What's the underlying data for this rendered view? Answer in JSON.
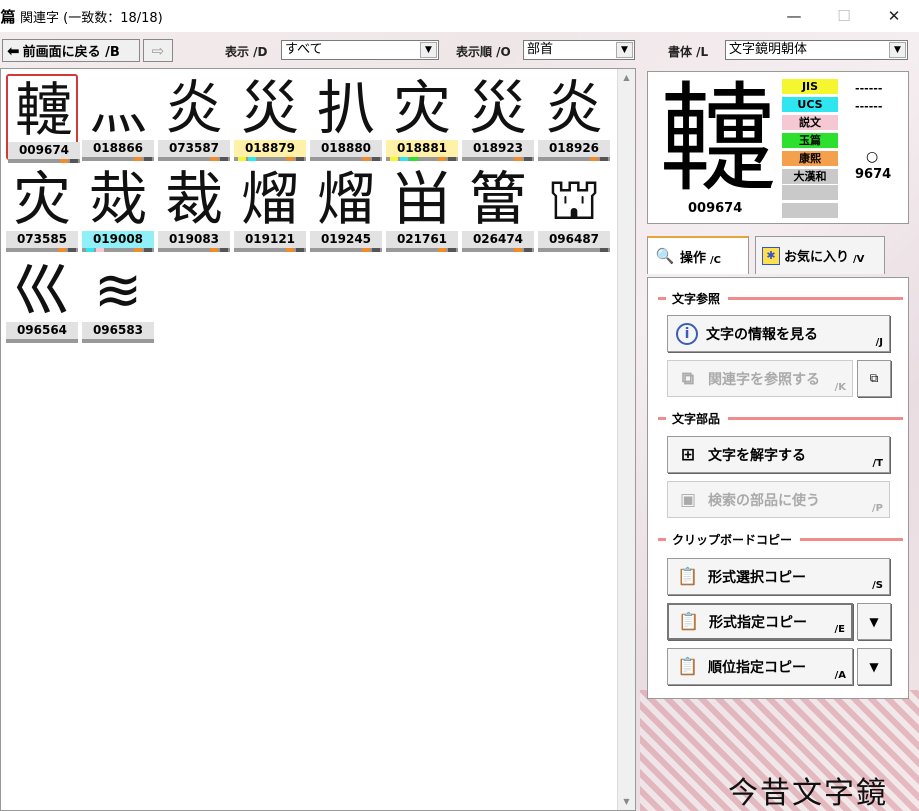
{
  "window": {
    "icon_glyph": "篇",
    "title": "関連字 (一致数：18/18)",
    "min_symbol": "—",
    "max_symbol": "☐",
    "close_symbol": "✕"
  },
  "toolbar": {
    "back_label": "前画面に戻る /B",
    "back_arrow": "⬅",
    "forward_arrow": "⇨",
    "display_label": "表示 /D",
    "display_value": "すべて",
    "order_label": "表示順 /O",
    "order_value": "部首",
    "font_label": "書体 /L",
    "font_value": "文字鏡明朝体",
    "dd_arrow": "▼"
  },
  "grid": {
    "cells": [
      {
        "glyph": "䡹",
        "code": "009674",
        "highlight": "",
        "selected": true
      },
      {
        "glyph": "灬",
        "code": "018866",
        "highlight": ""
      },
      {
        "glyph": "炎",
        "code": "073587",
        "highlight": ""
      },
      {
        "glyph": "災",
        "code": "018879",
        "highlight": "yellow"
      },
      {
        "glyph": "扒",
        "code": "018880",
        "highlight": ""
      },
      {
        "glyph": "灾",
        "code": "018881",
        "highlight": "yellow"
      },
      {
        "glyph": "災",
        "code": "018923",
        "highlight": ""
      },
      {
        "glyph": "炎",
        "code": "018926",
        "highlight": ""
      },
      {
        "glyph": "灾",
        "code": "073585",
        "highlight": ""
      },
      {
        "glyph": "烖",
        "code": "019008",
        "highlight": "cyan"
      },
      {
        "glyph": "裁",
        "code": "019083",
        "highlight": ""
      },
      {
        "glyph": "熘",
        "code": "019121",
        "highlight": ""
      },
      {
        "glyph": "熘",
        "code": "019245",
        "highlight": ""
      },
      {
        "glyph": "畄",
        "code": "021761",
        "highlight": ""
      },
      {
        "glyph": "簹",
        "code": "026474",
        "highlight": ""
      },
      {
        "glyph": "⛫",
        "code": "096487",
        "highlight": ""
      },
      {
        "glyph": "巛",
        "code": "096564",
        "highlight": ""
      },
      {
        "glyph": "≋",
        "code": "096583",
        "highlight": ""
      }
    ]
  },
  "preview": {
    "glyph": "䡹",
    "code": "009674",
    "sources": [
      {
        "label": "JIS",
        "color": "#f5f530"
      },
      {
        "label": "UCS",
        "color": "#2fe6f0"
      },
      {
        "label": "説文",
        "color": "#f5c8d4"
      },
      {
        "label": "玉篇",
        "color": "#2ee02e"
      },
      {
        "label": "康熙",
        "color": "#f5a04c"
      },
      {
        "label": "大漢和",
        "color": "#c9c9c9"
      }
    ],
    "jis_value": "------",
    "ucs_value": "------",
    "circle_mark": "○",
    "dkw_value": "9674"
  },
  "tabs": {
    "ops_label": "操作",
    "ops_key": "/C",
    "fav_label": "お気に入り",
    "fav_key": "/V"
  },
  "ops": {
    "section_ref": "文字参照",
    "info_label": "文字の情報を見る",
    "info_key": "/J",
    "related_label": "関連字を参照する",
    "related_key": "/K",
    "section_parts": "文字部品",
    "decompose_label": "文字を解字する",
    "decompose_key": "/T",
    "search_part_label": "検索の部品に使う",
    "search_part_key": "/P",
    "section_clip": "クリップボードコピー",
    "copy_select_label": "形式選択コピー",
    "copy_select_key": "/S",
    "copy_fixed_label": "形式指定コピー",
    "copy_fixed_key": "/E",
    "copy_order_label": "順位指定コピー",
    "copy_order_key": "/A",
    "dd_arrow": "▼"
  },
  "logo_text": "今昔文字鏡"
}
